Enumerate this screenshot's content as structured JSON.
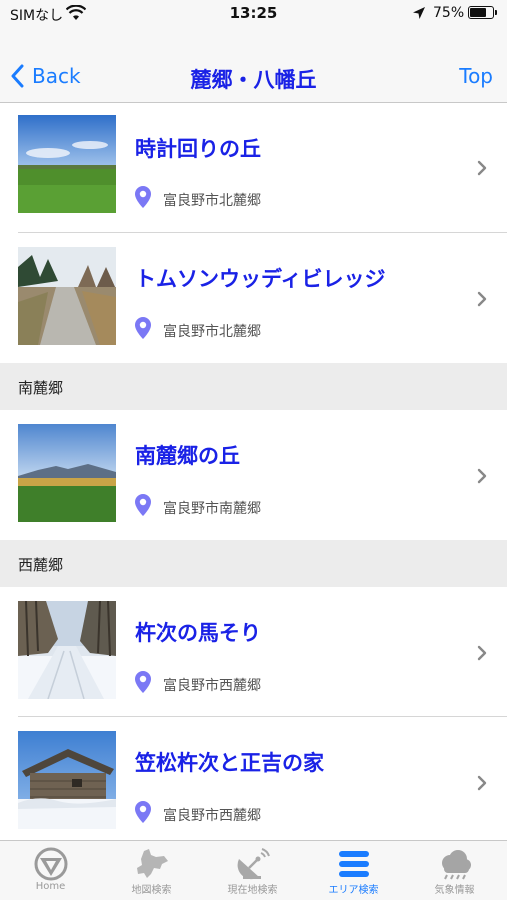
{
  "status_bar": {
    "carrier": "SIMなし",
    "time": "13:25",
    "battery_percent": "75%",
    "battery_level": 0.75
  },
  "nav": {
    "back_label": "Back",
    "title": "麓郷・八幡丘",
    "top_label": "Top"
  },
  "list": {
    "items_a": [
      {
        "name": "時計回りの丘",
        "address": "富良野市北麓郷"
      },
      {
        "name": "トムソンウッディビレッジ",
        "address": "富良野市北麓郷"
      }
    ],
    "section_b": "南麓郷",
    "items_b": [
      {
        "name": "南麓郷の丘",
        "address": "富良野市南麓郷"
      }
    ],
    "section_c": "西麓郷",
    "items_c": [
      {
        "name": "杵次の馬そり",
        "address": "富良野市西麓郷"
      },
      {
        "name": "笠松杵次と正吉の家",
        "address": "富良野市西麓郷"
      }
    ]
  },
  "tabbar": {
    "tabs": [
      {
        "label": "Home",
        "icon": "home-circle-icon"
      },
      {
        "label": "地図検索",
        "icon": "hokkaido-map-icon"
      },
      {
        "label": "現在地検索",
        "icon": "satellite-dish-icon"
      },
      {
        "label": "エリア検索",
        "icon": "list-bars-icon"
      },
      {
        "label": "気象情報",
        "icon": "cloud-weather-icon"
      }
    ],
    "active_index": 3
  },
  "colors": {
    "accent": "#1a7cff",
    "title_blue": "#1a22e6",
    "pin": "#7b78f5"
  }
}
